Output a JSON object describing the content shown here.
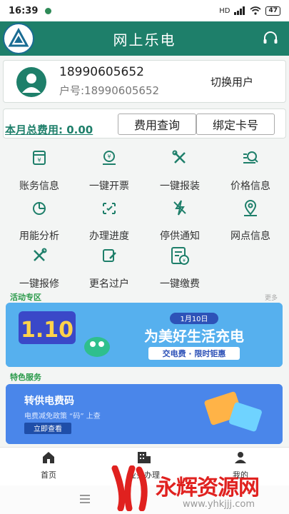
{
  "status": {
    "time": "16:39",
    "network": "HD",
    "battery": "47"
  },
  "header": {
    "title": "网上乐电"
  },
  "user": {
    "name": "18990605652",
    "account": "户号:18990605652",
    "switch_label": "切换用户"
  },
  "cost": {
    "month_fee": "本月总费用: 0.00",
    "query_label": "费用查询",
    "bind_label": "绑定卡号"
  },
  "services": [
    {
      "label": "账务信息",
      "icon": "ledger-icon"
    },
    {
      "label": "一键开票",
      "icon": "invoice-icon"
    },
    {
      "label": "一键报装",
      "icon": "install-icon"
    },
    {
      "label": "价格信息",
      "icon": "price-icon"
    },
    {
      "label": "用能分析",
      "icon": "pie-chart-icon"
    },
    {
      "label": "办理进度",
      "icon": "progress-icon"
    },
    {
      "label": "停供通知",
      "icon": "outage-icon"
    },
    {
      "label": "网点信息",
      "icon": "location-icon"
    },
    {
      "label": "一键报修",
      "icon": "repair-icon"
    },
    {
      "label": "更名过户",
      "icon": "rename-icon"
    },
    {
      "label": "一键缴费",
      "icon": "pay-icon"
    }
  ],
  "activity": {
    "title": "活动专区",
    "more": "更多",
    "banner": {
      "date": "1月10日",
      "big": "1.10",
      "headline": "为美好生活充电",
      "sub": "交电费 · 限时钜惠"
    }
  },
  "feature": {
    "title": "特色服务",
    "banner": {
      "title": "转供电费码",
      "sub": "电费减免政策 “码” 上查",
      "button": "立即查看"
    }
  },
  "tabs": [
    {
      "label": "首页",
      "icon": "home-icon"
    },
    {
      "label": "业务办理",
      "icon": "building-icon"
    },
    {
      "label": "我的",
      "icon": "person-icon"
    }
  ],
  "watermark": {
    "text": "永辉资源网",
    "url": "www.yhkjjj.com"
  },
  "colors": {
    "primary": "#1e7f6a",
    "accent_green": "#2a9a4a",
    "banner_blue": "#4ea7e8"
  }
}
